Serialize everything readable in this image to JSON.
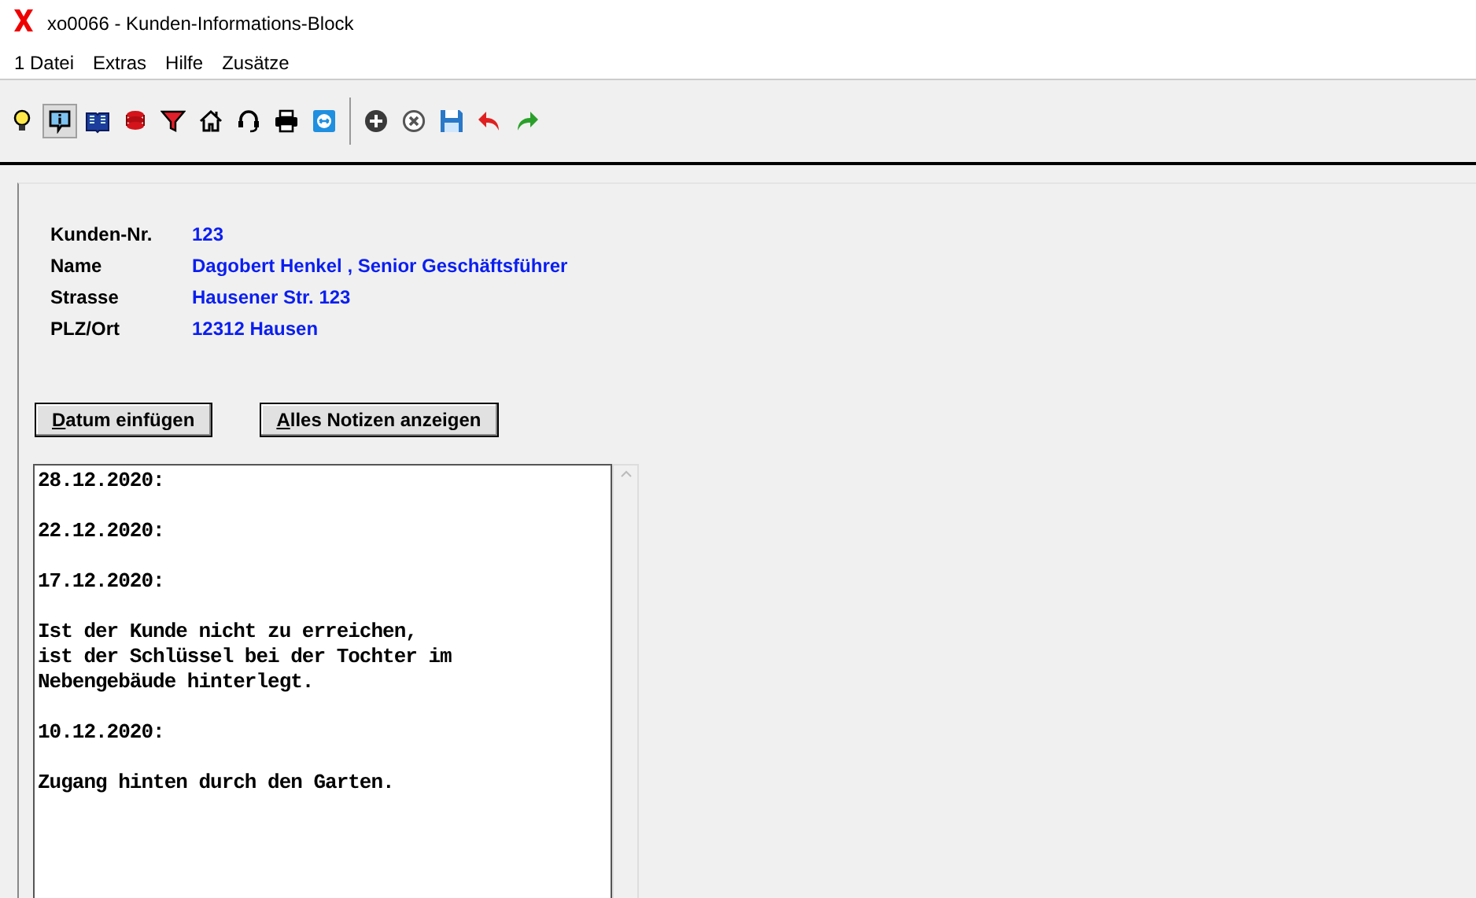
{
  "window": {
    "title": "xo0066 - Kunden-Informations-Block"
  },
  "menu": [
    "1 Datei",
    "Extras",
    "Hilfe",
    "Zusätze"
  ],
  "toolbar": [
    {
      "kind": "bulb",
      "pressed": false
    },
    {
      "kind": "info",
      "pressed": true
    },
    {
      "kind": "book",
      "pressed": false
    },
    {
      "kind": "database",
      "pressed": false
    },
    {
      "kind": "filter",
      "pressed": false
    },
    {
      "kind": "house",
      "pressed": false
    },
    {
      "kind": "headset",
      "pressed": false
    },
    {
      "kind": "printer",
      "pressed": false
    },
    {
      "kind": "remote",
      "pressed": false
    },
    {
      "kind": "separator"
    },
    {
      "kind": "add",
      "pressed": false
    },
    {
      "kind": "remove",
      "pressed": false
    },
    {
      "kind": "save",
      "pressed": false
    },
    {
      "kind": "undo",
      "pressed": false
    },
    {
      "kind": "redo",
      "pressed": false
    }
  ],
  "fields": [
    {
      "label": "Kunden-Nr.",
      "value": "123"
    },
    {
      "label": "Name",
      "value": "Dagobert Henkel , Senior Geschäftsführer"
    },
    {
      "label": "Strasse",
      "value": "Hausener Str. 123"
    },
    {
      "label": "PLZ/Ort",
      "value": "12312 Hausen"
    }
  ],
  "buttons": [
    {
      "label": "Datum einfügen",
      "mnemonic": true
    },
    {
      "label": "Alles Notizen anzeigen",
      "mnemonic": true
    }
  ],
  "notes": [
    "28.12.2020:",
    "22.12.2020:",
    "17.12.2020:",
    "Ist der Kunde nicht zu erreichen,\nist der Schlüssel bei der Tochter im\nNebengebäude hinterlegt.",
    "10.12.2020:",
    "Zugang hinten durch den Garten."
  ]
}
